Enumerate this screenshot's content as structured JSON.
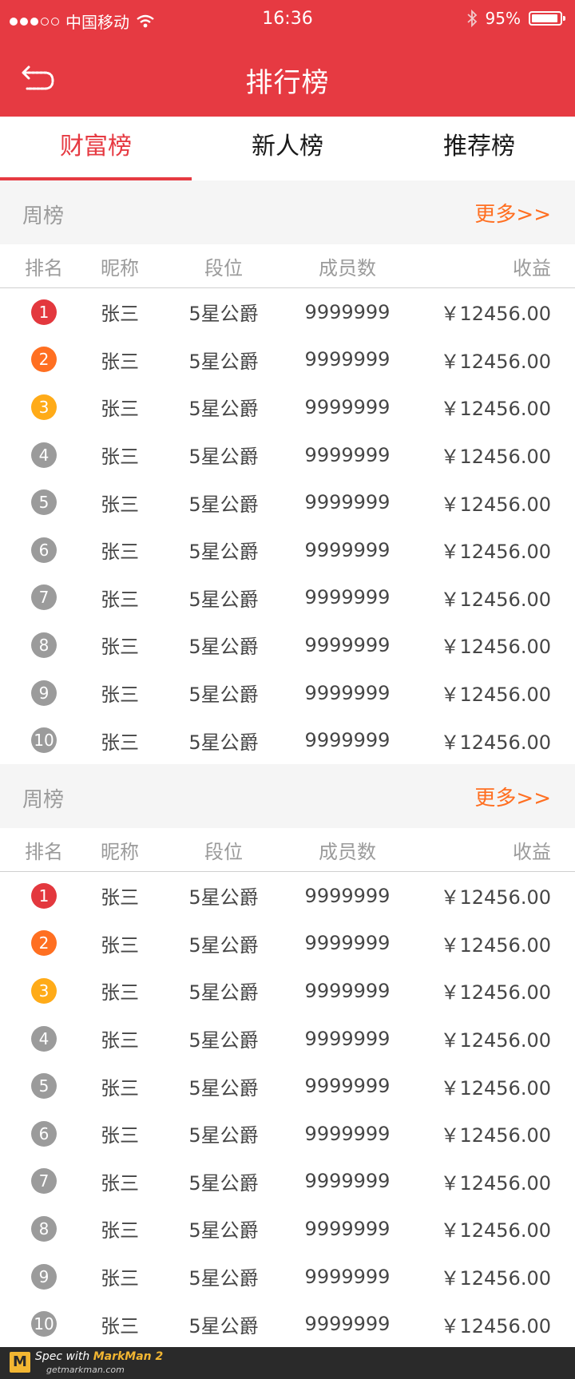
{
  "status_bar": {
    "carrier": "中国移动",
    "time": "16:36",
    "battery": "95%",
    "battery_level": 0.95
  },
  "header": {
    "title": "排行榜"
  },
  "tabs": [
    {
      "label": "财富榜",
      "active": true
    },
    {
      "label": "新人榜",
      "active": false
    },
    {
      "label": "推荐榜",
      "active": false
    }
  ],
  "colors": {
    "brand_red": "#e63a42",
    "rank_1": "#e3383e",
    "rank_2": "#ff6f21",
    "rank_3": "#ffab18",
    "rank_other": "#9b9b9b",
    "more": "#ff6f21"
  },
  "columns": [
    "排名",
    "昵称",
    "段位",
    "成员数",
    "收益"
  ],
  "sections": [
    {
      "title": "周榜",
      "more": "更多>>",
      "rows": [
        {
          "rank": "1",
          "name": "张三",
          "level": "5星公爵",
          "count": "9999999",
          "income": "￥12456.00"
        },
        {
          "rank": "2",
          "name": "张三",
          "level": "5星公爵",
          "count": "9999999",
          "income": "￥12456.00"
        },
        {
          "rank": "3",
          "name": "张三",
          "level": "5星公爵",
          "count": "9999999",
          "income": "￥12456.00"
        },
        {
          "rank": "4",
          "name": "张三",
          "level": "5星公爵",
          "count": "9999999",
          "income": "￥12456.00"
        },
        {
          "rank": "5",
          "name": "张三",
          "level": "5星公爵",
          "count": "9999999",
          "income": "￥12456.00"
        },
        {
          "rank": "6",
          "name": "张三",
          "level": "5星公爵",
          "count": "9999999",
          "income": "￥12456.00"
        },
        {
          "rank": "7",
          "name": "张三",
          "level": "5星公爵",
          "count": "9999999",
          "income": "￥12456.00"
        },
        {
          "rank": "8",
          "name": "张三",
          "level": "5星公爵",
          "count": "9999999",
          "income": "￥12456.00"
        },
        {
          "rank": "9",
          "name": "张三",
          "level": "5星公爵",
          "count": "9999999",
          "income": "￥12456.00"
        },
        {
          "rank": "10",
          "name": "张三",
          "level": "5星公爵",
          "count": "9999999",
          "income": "￥12456.00"
        }
      ]
    },
    {
      "title": "周榜",
      "more": "更多>>",
      "rows": [
        {
          "rank": "1",
          "name": "张三",
          "level": "5星公爵",
          "count": "9999999",
          "income": "￥12456.00"
        },
        {
          "rank": "2",
          "name": "张三",
          "level": "5星公爵",
          "count": "9999999",
          "income": "￥12456.00"
        },
        {
          "rank": "3",
          "name": "张三",
          "level": "5星公爵",
          "count": "9999999",
          "income": "￥12456.00"
        },
        {
          "rank": "4",
          "name": "张三",
          "level": "5星公爵",
          "count": "9999999",
          "income": "￥12456.00"
        },
        {
          "rank": "5",
          "name": "张三",
          "level": "5星公爵",
          "count": "9999999",
          "income": "￥12456.00"
        },
        {
          "rank": "6",
          "name": "张三",
          "level": "5星公爵",
          "count": "9999999",
          "income": "￥12456.00"
        },
        {
          "rank": "7",
          "name": "张三",
          "level": "5星公爵",
          "count": "9999999",
          "income": "￥12456.00"
        },
        {
          "rank": "8",
          "name": "张三",
          "level": "5星公爵",
          "count": "9999999",
          "income": "￥12456.00"
        },
        {
          "rank": "9",
          "name": "张三",
          "level": "5星公爵",
          "count": "9999999",
          "income": "￥12456.00"
        },
        {
          "rank": "10",
          "name": "张三",
          "level": "5星公爵",
          "count": "9999999",
          "income": "￥12456.00"
        }
      ]
    }
  ],
  "footer": {
    "logo_letter": "M",
    "brand_prefix": "Spec with ",
    "brand_name": "MarkMan 2",
    "site": "getmarkman.com"
  }
}
